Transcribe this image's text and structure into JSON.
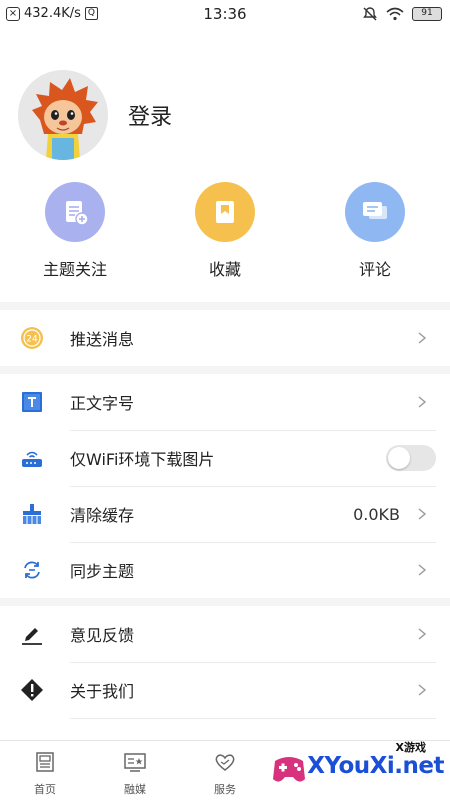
{
  "status_bar": {
    "speed": "432.4K/s",
    "time": "13:36",
    "battery": "91"
  },
  "profile": {
    "login_label": "登录"
  },
  "quick_actions": [
    {
      "label": "主题关注",
      "icon": "document-add-icon",
      "color": "#a9b1ef"
    },
    {
      "label": "收藏",
      "icon": "bookmark-icon",
      "color": "#f6c04f"
    },
    {
      "label": "评论",
      "icon": "chat-bubbles-icon",
      "color": "#8fb7f2"
    }
  ],
  "settings": {
    "push": {
      "label": "推送消息",
      "badge": "24"
    },
    "font_size": {
      "label": "正文字号"
    },
    "wifi_only": {
      "label": "仅WiFi环境下载图片",
      "enabled": false
    },
    "clear_cache": {
      "label": "清除缓存",
      "value": "0.0KB"
    },
    "sync_theme": {
      "label": "同步主题"
    },
    "feedback": {
      "label": "意见反馈"
    },
    "about": {
      "label": "关于我们"
    }
  },
  "bottom_nav": [
    {
      "label": "首页",
      "icon": "newspaper-icon"
    },
    {
      "label": "融媒",
      "icon": "media-card-icon"
    },
    {
      "label": "服务",
      "icon": "heart-hands-icon"
    },
    {
      "label": "",
      "icon": "hidden-icon"
    },
    {
      "label": "",
      "icon": "hidden-icon"
    }
  ],
  "watermark": {
    "title": "X游戏",
    "text": "XYouXi.net"
  },
  "colors": {
    "accent_blue": "#2b6fd6",
    "separator": "#f4f4f4"
  }
}
